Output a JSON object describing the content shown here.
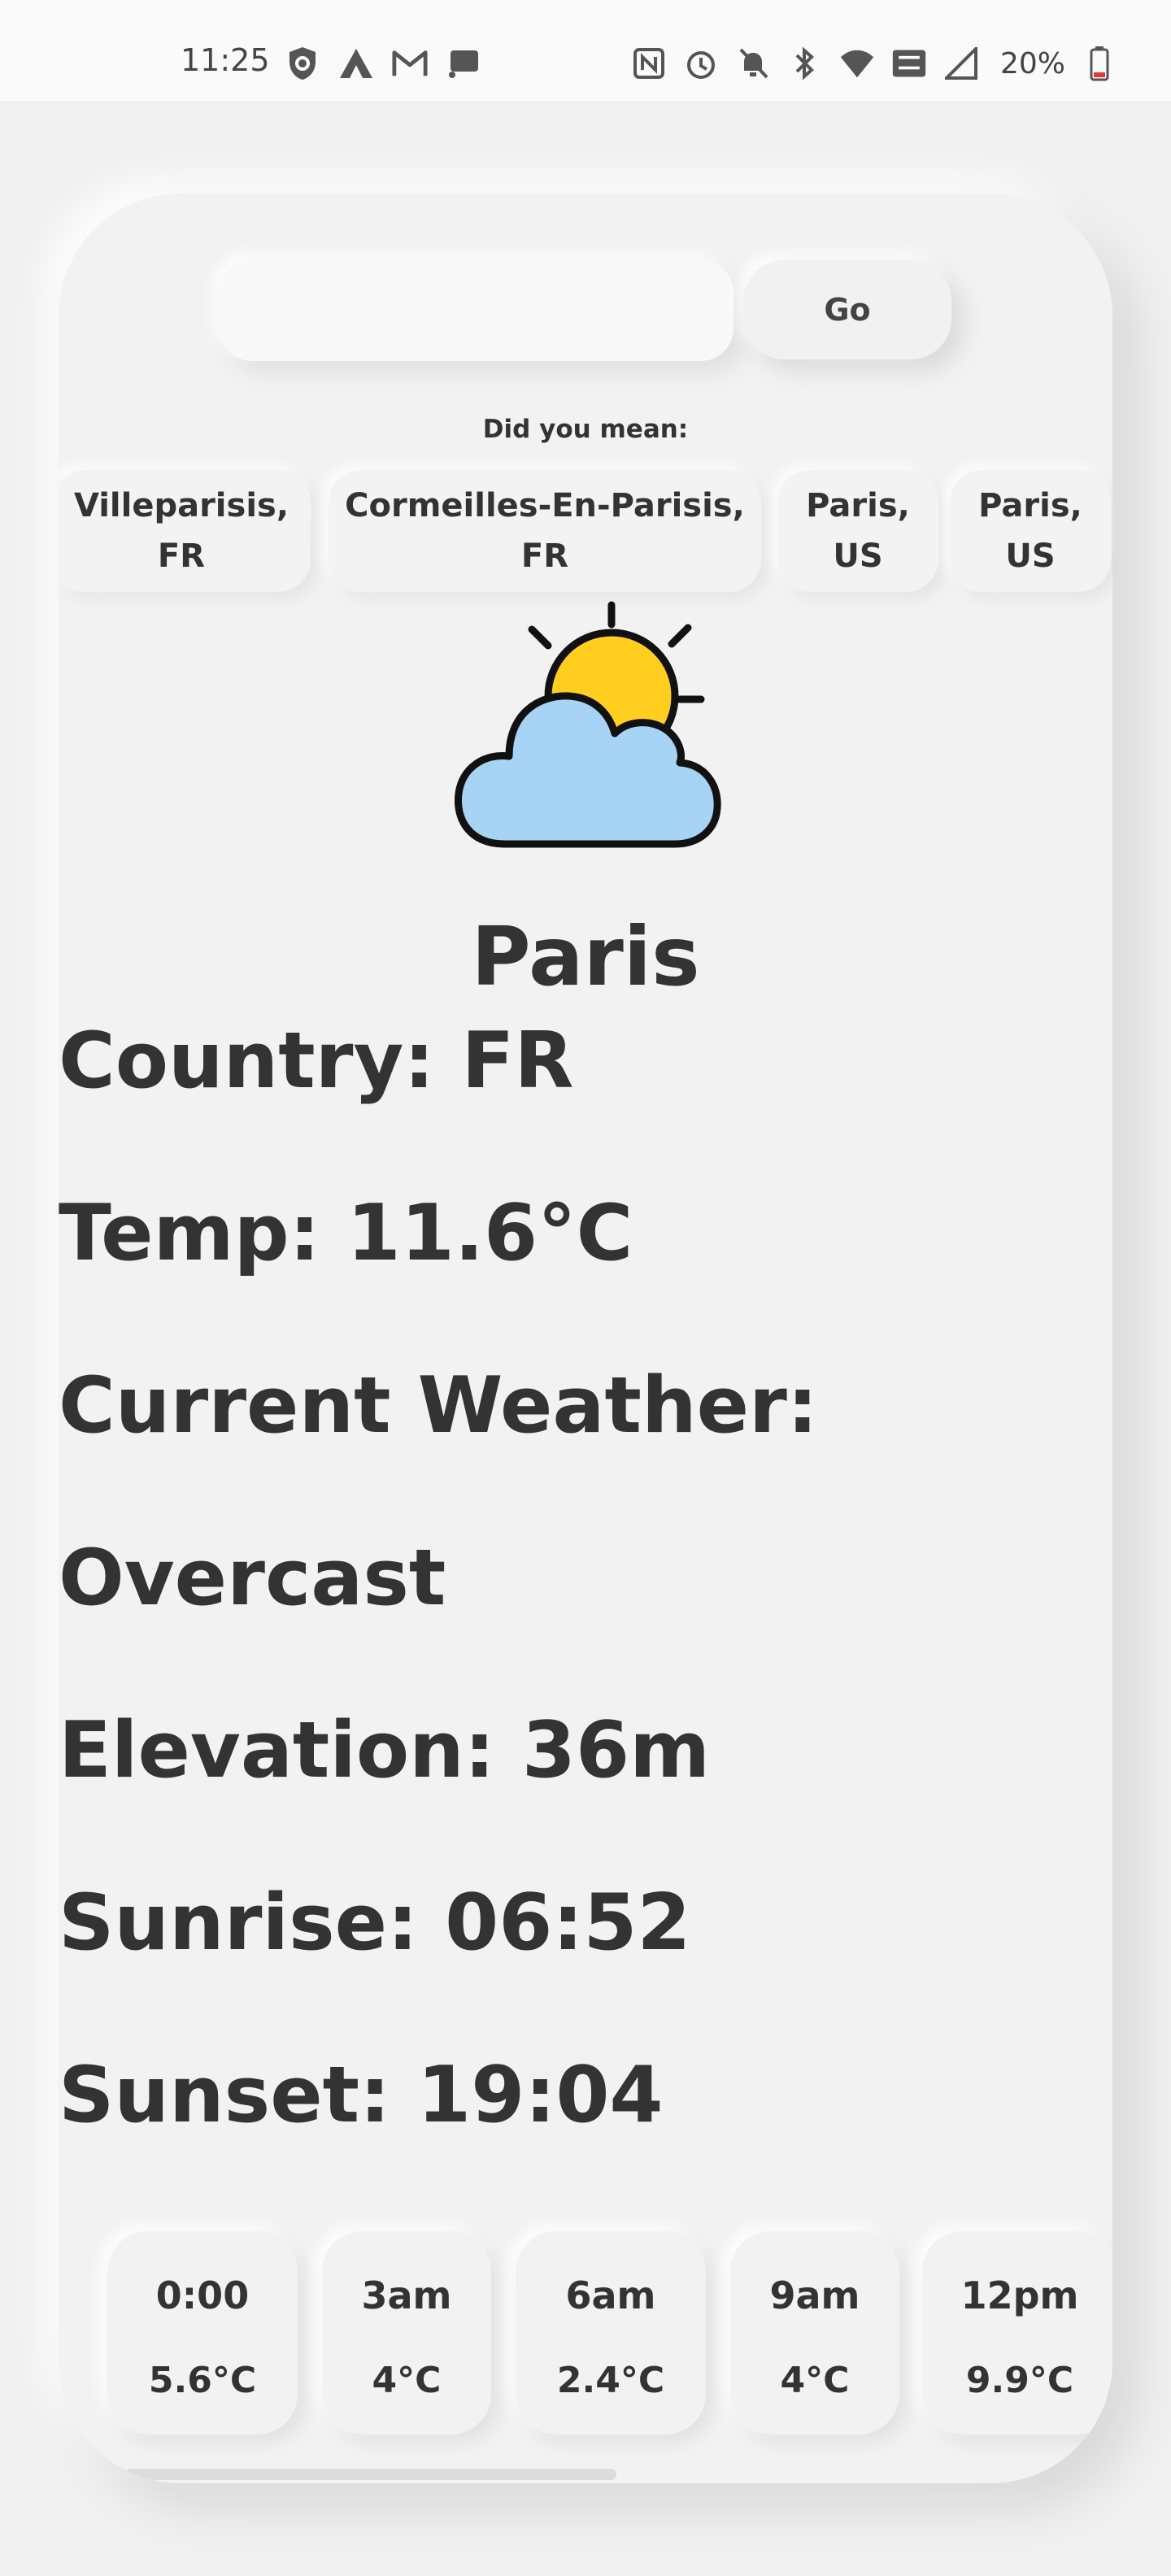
{
  "status_bar": {
    "time": "11:25",
    "battery": "20%",
    "left_icons": [
      "shield-icon",
      "artstation-icon",
      "gmail-icon",
      "cast-icon"
    ],
    "right_icons": [
      "nfc-icon",
      "alarm-icon",
      "bell-off-icon",
      "bluetooth-icon",
      "wifi-icon",
      "vowifi-icon",
      "signal-icon",
      "battery-icon"
    ]
  },
  "search": {
    "placeholder": "",
    "value": "",
    "go_label": "Go"
  },
  "suggestions": {
    "heading": "Did you mean:",
    "items": [
      {
        "line1": "Villeparisis,",
        "line2": "FR"
      },
      {
        "line1": "Cormeilles-En-Parisis,",
        "line2": "FR"
      },
      {
        "line1": "Paris,",
        "line2": "US"
      },
      {
        "line1": "Paris,",
        "line2": "US"
      }
    ]
  },
  "weather": {
    "icon": "partly-cloudy-icon",
    "city": "Paris",
    "country": "Country: FR",
    "temp": "Temp: 11.6°C",
    "current_label": "Current Weather:",
    "current_value": "Overcast",
    "elevation": "Elevation: 36m",
    "sunrise": "Sunrise: 06:52",
    "sunset": "Sunset: 19:04"
  },
  "hourly": [
    {
      "time": "0:00",
      "temp": "5.6°C"
    },
    {
      "time": "3am",
      "temp": "4°C"
    },
    {
      "time": "6am",
      "temp": "2.4°C"
    },
    {
      "time": "9am",
      "temp": "4°C"
    },
    {
      "time": "12pm",
      "temp": "9.9°C"
    }
  ],
  "colors": {
    "background": "#f0f0f0",
    "text": "#333333",
    "sun": "#FFCE1F",
    "cloud": "#A7D3F5"
  }
}
